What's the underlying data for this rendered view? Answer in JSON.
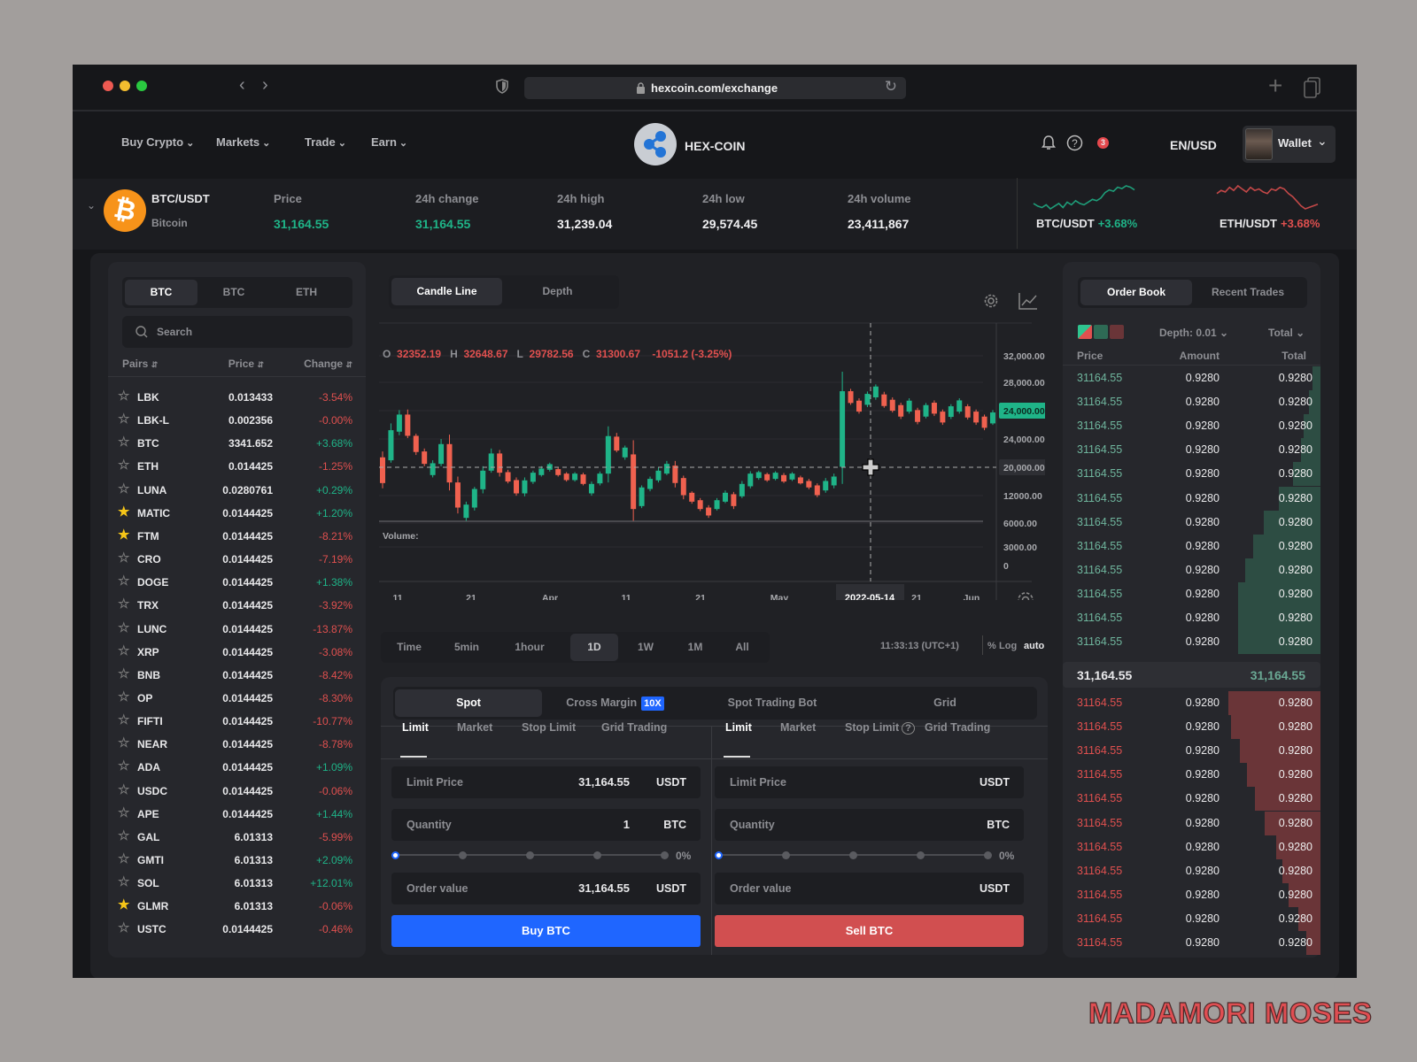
{
  "browser": {
    "url": "hexcoin.com/exchange"
  },
  "nav": {
    "items": [
      {
        "label": "Buy Crypto"
      },
      {
        "label": "Markets"
      },
      {
        "label": "Trade"
      },
      {
        "label": "Earn"
      }
    ],
    "brand": "HEX-COIN",
    "notification_count": "3",
    "locale": "EN/USD",
    "wallet": "Wallet"
  },
  "ticker": {
    "pair": "BTC/USDT",
    "name": "Bitcoin",
    "stats": [
      {
        "label": "Price",
        "value": "31,164.55",
        "color": "green"
      },
      {
        "label": "24h change",
        "value": "31,164.55",
        "color": "green"
      },
      {
        "label": "24h high",
        "value": "31,239.04",
        "color": "white"
      },
      {
        "label": "24h  low",
        "value": "29,574.45",
        "color": "white"
      },
      {
        "label": "24h  volume",
        "value": "23,411,867",
        "color": "white"
      }
    ],
    "sparks": [
      {
        "pair": "BTC/USDT",
        "change": "+3.68%",
        "color": "#1fb488",
        "values": [
          5,
          3,
          2,
          4,
          1,
          3,
          5,
          2,
          6,
          4,
          7,
          5,
          4,
          6,
          8,
          7,
          9,
          13,
          15,
          14,
          17,
          16,
          18,
          17,
          15
        ]
      },
      {
        "pair": "ETH/USDT",
        "change": "+3.68%",
        "color": "#e0504f",
        "values": [
          14,
          16,
          15,
          18,
          16,
          19,
          17,
          15,
          18,
          16,
          17,
          15,
          14,
          17,
          16,
          18,
          17,
          14,
          12,
          9,
          6,
          4,
          5,
          6,
          7
        ]
      }
    ]
  },
  "pairs_panel": {
    "tabs": [
      {
        "label": "BTC"
      },
      {
        "label": "BTC"
      },
      {
        "label": "ETH"
      }
    ],
    "active_tab": 0,
    "search_placeholder": "Search",
    "columns": {
      "pairs": "Pairs",
      "price": "Price",
      "change": "Change"
    },
    "rows": [
      {
        "name": "LBK",
        "price": "0.013433",
        "change": "-3.54%",
        "fav": false
      },
      {
        "name": "LBK-L",
        "price": "0.002356",
        "change": "-0.00%",
        "fav": false
      },
      {
        "name": "BTC",
        "price": "3341.652",
        "change": "+3.68%",
        "fav": false
      },
      {
        "name": "ETH",
        "price": "0.014425",
        "change": "-1.25%",
        "fav": false
      },
      {
        "name": "LUNA",
        "price": "0.0280761",
        "change": "+0.29%",
        "fav": false
      },
      {
        "name": "MATIC",
        "price": "0.0144425",
        "change": "+1.20%",
        "fav": true
      },
      {
        "name": "FTM",
        "price": "0.0144425",
        "change": "-8.21%",
        "fav": true
      },
      {
        "name": "CRO",
        "price": "0.0144425",
        "change": "-7.19%",
        "fav": false
      },
      {
        "name": "DOGE",
        "price": "0.0144425",
        "change": "+1.38%",
        "fav": false
      },
      {
        "name": "TRX",
        "price": "0.0144425",
        "change": "-3.92%",
        "fav": false
      },
      {
        "name": "LUNC",
        "price": "0.0144425",
        "change": "-13.87%",
        "fav": false
      },
      {
        "name": "XRP",
        "price": "0.0144425",
        "change": "-3.08%",
        "fav": false
      },
      {
        "name": "BNB",
        "price": "0.0144425",
        "change": "-8.42%",
        "fav": false
      },
      {
        "name": "OP",
        "price": "0.0144425",
        "change": "-8.30%",
        "fav": false
      },
      {
        "name": "FIFTI",
        "price": "0.0144425",
        "change": "-10.77%",
        "fav": false
      },
      {
        "name": "NEAR",
        "price": "0.0144425",
        "change": "-8.78%",
        "fav": false
      },
      {
        "name": "ADA",
        "price": "0.0144425",
        "change": "+1.09%",
        "fav": false
      },
      {
        "name": "USDC",
        "price": "0.0144425",
        "change": "-0.06%",
        "fav": false
      },
      {
        "name": "APE",
        "price": "0.0144425",
        "change": "+1.44%",
        "fav": false
      },
      {
        "name": "GAL",
        "price": "6.01313",
        "change": "-5.99%",
        "fav": false
      },
      {
        "name": "GMTI",
        "price": "6.01313",
        "change": "+2.09%",
        "fav": false
      },
      {
        "name": "SOL",
        "price": "6.01313",
        "change": "+12.01%",
        "fav": false
      },
      {
        "name": "GLMR",
        "price": "6.01313",
        "change": "-0.06%",
        "fav": true
      },
      {
        "name": "USTC",
        "price": "0.0144425",
        "change": "-0.46%",
        "fav": false
      }
    ]
  },
  "chart": {
    "tabs": [
      {
        "label": "Candle Line"
      },
      {
        "label": "Depth"
      }
    ],
    "active_tab": 0,
    "ohlc": {
      "o_label": "O",
      "o": "32352.19",
      "h_label": "H",
      "h": "32648.67",
      "l_label": "L",
      "l": "29782.56",
      "c_label": "C",
      "c": "31300.67",
      "change": "-1051.2 (-3.25%)"
    },
    "y_ticks": [
      "32,000.00",
      "28,000.00",
      "24,000.00",
      "24,000.00",
      "20,000.00",
      "12000.00",
      "6000.00",
      "3000.00",
      "0"
    ],
    "current_price_tick": 2,
    "crosshair_tick": 4,
    "x_ticks": [
      "11",
      "21",
      "Apr",
      "11",
      "21",
      "May",
      "2022-05-14",
      "21",
      "Jun"
    ],
    "crosshair_date_tick": 6,
    "volume_label": "Volume:",
    "up_color": "#1fb488",
    "down_color": "#f0614f",
    "candles": [
      [
        17480,
        18320,
        13060,
        13810
      ],
      [
        17060,
        22320,
        16720,
        21350
      ],
      [
        21140,
        24220,
        20640,
        23580
      ],
      [
        23580,
        24300,
        20220,
        20550
      ],
      [
        20550,
        20850,
        17820,
        18240
      ],
      [
        18320,
        18740,
        16220,
        16550
      ],
      [
        14950,
        17060,
        14620,
        16640
      ],
      [
        16550,
        20090,
        16220,
        19370
      ],
      [
        19370,
        20720,
        12760,
        13900
      ],
      [
        13900,
        14740,
        9480,
        10320
      ],
      [
        8850,
        11160,
        8430,
        10740
      ],
      [
        10320,
        13270,
        9900,
        12970
      ],
      [
        12930,
        16220,
        12340,
        15580
      ],
      [
        15580,
        18740,
        15290,
        18030
      ],
      [
        18030,
        18530,
        14740,
        15290
      ],
      [
        15370,
        15710,
        13770,
        14030
      ],
      [
        14240,
        14620,
        12010,
        12340
      ],
      [
        12340,
        14620,
        11920,
        14200
      ],
      [
        13990,
        15580,
        13690,
        15290
      ],
      [
        14950,
        16220,
        14740,
        15880
      ],
      [
        15710,
        16720,
        15460,
        16510
      ],
      [
        15800,
        16010,
        14740,
        14950
      ],
      [
        15160,
        15370,
        14030,
        14240
      ],
      [
        14240,
        15370,
        14030,
        15160
      ],
      [
        15040,
        15290,
        13480,
        13690
      ],
      [
        12340,
        14030,
        12010,
        13690
      ],
      [
        13770,
        15460,
        13480,
        15160
      ],
      [
        15160,
        21900,
        13900,
        20510
      ],
      [
        20430,
        20970,
        18200,
        18450
      ],
      [
        17480,
        19160,
        17140,
        18870
      ],
      [
        17900,
        19920,
        8430,
        10110
      ],
      [
        10530,
        13480,
        10240,
        13190
      ],
      [
        12970,
        14740,
        12640,
        14410
      ],
      [
        14200,
        16010,
        13900,
        15580
      ],
      [
        15160,
        16970,
        14950,
        16550
      ],
      [
        16300,
        16970,
        13190,
        13820
      ],
      [
        14530,
        14870,
        11500,
        12090
      ],
      [
        12430,
        12640,
        10870,
        11160
      ],
      [
        11370,
        11670,
        9820,
        10110
      ],
      [
        10320,
        10660,
        8850,
        9190
      ],
      [
        10110,
        11670,
        9900,
        11370
      ],
      [
        11160,
        12760,
        10950,
        12430
      ],
      [
        12220,
        12550,
        10110,
        10530
      ],
      [
        11920,
        14110,
        11670,
        13690
      ],
      [
        13350,
        15500,
        13060,
        15160
      ],
      [
        14530,
        15580,
        14280,
        15370
      ],
      [
        15080,
        15290,
        13990,
        14200
      ],
      [
        14410,
        15500,
        14200,
        15290
      ],
      [
        14950,
        15250,
        13820,
        14030
      ],
      [
        14320,
        15370,
        14110,
        15160
      ],
      [
        14620,
        14870,
        13610,
        13770
      ],
      [
        14110,
        14410,
        12930,
        13190
      ],
      [
        13480,
        13770,
        11800,
        12090
      ],
      [
        12760,
        14530,
        12430,
        14110
      ],
      [
        13480,
        15160,
        13060,
        14740
      ],
      [
        16130,
        29690,
        13690,
        26910
      ],
      [
        26910,
        27250,
        24970,
        25230
      ],
      [
        25560,
        25900,
        23710,
        24000
      ],
      [
        24970,
        26870,
        24640,
        26530
      ],
      [
        26030,
        27880,
        25690,
        27580
      ],
      [
        26450,
        26830,
        24550,
        24800
      ],
      [
        25690,
        26030,
        23880,
        24130
      ],
      [
        24930,
        25270,
        22950,
        23290
      ],
      [
        24000,
        25900,
        23710,
        25560
      ],
      [
        24220,
        24550,
        22190,
        22530
      ],
      [
        23290,
        25230,
        23040,
        24930
      ],
      [
        25270,
        25600,
        23370,
        23710
      ],
      [
        24000,
        24300,
        22110,
        22450
      ],
      [
        23250,
        25060,
        22950,
        24760
      ],
      [
        24000,
        25900,
        23710,
        25600
      ],
      [
        24760,
        25060,
        22870,
        23160
      ],
      [
        24000,
        24300,
        22110,
        22450
      ],
      [
        23290,
        23580,
        21350,
        21690
      ],
      [
        22320,
        24220,
        22110,
        23880
      ]
    ],
    "timeframes": [
      {
        "label": "Time"
      },
      {
        "label": "5min"
      },
      {
        "label": "1hour"
      },
      {
        "label": "1D"
      },
      {
        "label": "1W"
      },
      {
        "label": "1M"
      },
      {
        "label": "All"
      }
    ],
    "active_timeframe": 3,
    "clock": "11:33:13 (UTC+1)",
    "scale_pct": "%",
    "scale_log": "Log",
    "scale_auto": "auto"
  },
  "order_form": {
    "tabs": [
      {
        "label": "Spot"
      },
      {
        "label": "Cross Margin",
        "badge": "10X"
      },
      {
        "label": "Spot Trading Bot"
      },
      {
        "label": "Grid"
      }
    ],
    "active_tab": 0,
    "buy": {
      "types": [
        {
          "label": "Limit"
        },
        {
          "label": "Market"
        },
        {
          "label": "Stop Limit"
        },
        {
          "label": "Grid Trading"
        }
      ],
      "limit_price_label": "Limit Price",
      "limit_price": "31,164.55",
      "limit_unit": "USDT",
      "quantity_label": "Quantity",
      "quantity": "1",
      "quantity_unit": "BTC",
      "slider_pct_label": "0%",
      "slider_value": 0,
      "order_value_label": "Order value",
      "order_value": "31,164.55",
      "order_value_unit": "USDT",
      "button": "Buy BTC",
      "color": "#1f66ff"
    },
    "sell": {
      "types": [
        {
          "label": "Limit"
        },
        {
          "label": "Market"
        },
        {
          "label": "Stop Limit"
        },
        {
          "label": "Grid Trading"
        }
      ],
      "limit_price_label": "Limit Price",
      "limit_price": "",
      "limit_unit": "USDT",
      "quantity_label": "Quantity",
      "quantity": "",
      "quantity_unit": "BTC",
      "slider_pct_label": "0%",
      "slider_value": 0,
      "order_value_label": "Order value",
      "order_value": "",
      "order_value_unit": "USDT",
      "button": "Sell BTC",
      "color": "#d14f50"
    }
  },
  "order_book": {
    "tabs": [
      {
        "label": "Order Book"
      },
      {
        "label": "Recent Trades"
      }
    ],
    "active_tab": 0,
    "depth": "Depth: 0.01",
    "total_select": "Total",
    "columns": {
      "price": "Price",
      "amount": "Amount",
      "total": "Total"
    },
    "asks": [
      {
        "price": "31164.55",
        "amount": "0.9280",
        "total": "0.9280",
        "depth": 0.08
      },
      {
        "price": "31164.55",
        "amount": "0.9280",
        "total": "0.9280",
        "depth": 0.12
      },
      {
        "price": "31164.55",
        "amount": "0.9280",
        "total": "0.9280",
        "depth": 0.17
      },
      {
        "price": "31164.55",
        "amount": "0.9280",
        "total": "0.9280",
        "depth": 0.2
      },
      {
        "price": "31164.55",
        "amount": "0.9280",
        "total": "0.9280",
        "depth": 0.28
      },
      {
        "price": "31164.55",
        "amount": "0.9280",
        "total": "0.9280",
        "depth": 0.42
      },
      {
        "price": "31164.55",
        "amount": "0.9280",
        "total": "0.9280",
        "depth": 0.57
      },
      {
        "price": "31164.55",
        "amount": "0.9280",
        "total": "0.9280",
        "depth": 0.68
      },
      {
        "price": "31164.55",
        "amount": "0.9280",
        "total": "0.9280",
        "depth": 0.76
      },
      {
        "price": "31164.55",
        "amount": "0.9280",
        "total": "0.9280",
        "depth": 0.83
      },
      {
        "price": "31164.55",
        "amount": "0.9280",
        "total": "0.9280",
        "depth": 0.83
      },
      {
        "price": "31164.55",
        "amount": "0.9280",
        "total": "0.9280",
        "depth": 0.83
      }
    ],
    "mid_price": "31,164.55",
    "mid_price_alt": "31,164.55",
    "bids": [
      {
        "price": "31164.55",
        "amount": "0.9280",
        "total": "0.9280",
        "depth": 0.93
      },
      {
        "price": "31164.55",
        "amount": "0.9280",
        "total": "0.9280",
        "depth": 0.9
      },
      {
        "price": "31164.55",
        "amount": "0.9280",
        "total": "0.9280",
        "depth": 0.81
      },
      {
        "price": "31164.55",
        "amount": "0.9280",
        "total": "0.9280",
        "depth": 0.74
      },
      {
        "price": "31164.55",
        "amount": "0.9280",
        "total": "0.9280",
        "depth": 0.66
      },
      {
        "price": "31164.55",
        "amount": "0.9280",
        "total": "0.9280",
        "depth": 0.56
      },
      {
        "price": "31164.55",
        "amount": "0.9280",
        "total": "0.9280",
        "depth": 0.45
      },
      {
        "price": "31164.55",
        "amount": "0.9280",
        "total": "0.9280",
        "depth": 0.38
      },
      {
        "price": "31164.55",
        "amount": "0.9280",
        "total": "0.9280",
        "depth": 0.32
      },
      {
        "price": "31164.55",
        "amount": "0.9280",
        "total": "0.9280",
        "depth": 0.22
      },
      {
        "price": "31164.55",
        "amount": "0.9280",
        "total": "0.9280",
        "depth": 0.14
      }
    ]
  },
  "watermark": "MADAMORI MOSES"
}
